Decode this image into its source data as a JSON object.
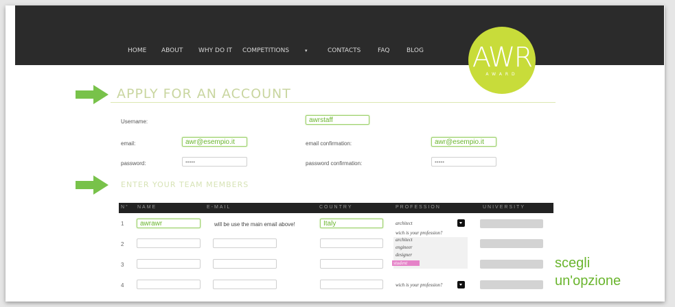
{
  "nav": {
    "items": [
      "HOME",
      "ABOUT",
      "WHY DO IT",
      "COMPETITIONS",
      "CONTACTS",
      "FAQ",
      "BLOG"
    ],
    "competitions_arrow": "▾"
  },
  "logo": {
    "text": "AWR",
    "sub": "AWARD"
  },
  "section1": {
    "title": "APPLY FOR AN ACCOUNT"
  },
  "account": {
    "username_label": "Username:",
    "username_value": "awrstaff",
    "email_label": "email:",
    "email_value": "awr@esempio.it",
    "email_confirm_label": "email confirmation:",
    "email_confirm_value": "awr@esempio.it",
    "password_label": "password:",
    "password_value": "•••••",
    "password_confirm_label": "password confirmation:",
    "password_confirm_value": "•••••"
  },
  "section2": {
    "title": "ENTER YOUR TEAM MEMBERS"
  },
  "table": {
    "headers": [
      "N°",
      "NAME",
      "E-MAIL",
      "COUNTRY",
      "PROFESSION",
      "UNIVERSITY"
    ],
    "rows": [
      {
        "num": "1",
        "name": "awrawr",
        "email": "will be use the main email above!",
        "country": "Italy",
        "profession": "architect"
      },
      {
        "num": "2"
      },
      {
        "num": "3"
      },
      {
        "num": "4",
        "profession": "wich is your profession?"
      }
    ],
    "dropdown_placeholder": "wich is your profession?",
    "dropdown_options": [
      "architect",
      "engineer",
      "designer",
      "student"
    ],
    "dropdown_selected": "student"
  },
  "annotation": {
    "line1": "scegli",
    "line2": "un'opzione"
  },
  "colors": {
    "accent_green": "#6ab52e",
    "logo_yellow": "#c8dc3a",
    "header_dark": "#2b2b2b",
    "highlight_pink": "#e582c8"
  }
}
